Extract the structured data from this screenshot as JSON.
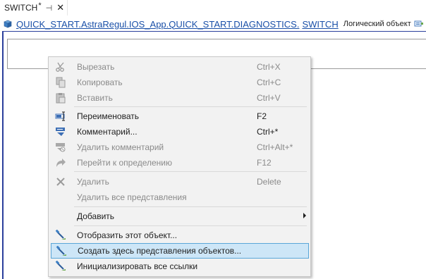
{
  "tab": {
    "title": "SWITCH",
    "modified_mark": "*",
    "pin_glyph": "⊣",
    "close_glyph": "✕"
  },
  "breadcrumb": {
    "path": "QUICK_START.AstraRegul.IOS_App.QUICK_START.DIAGNOSTICS.",
    "current": "SWITCH",
    "type_label": "Логический объект",
    "leading_icon": "cube-icon",
    "trailing_icon": "logical-object-icon"
  },
  "colors": {
    "link": "#1a50a8",
    "highlight_bg": "#cde6f7",
    "highlight_border": "#5aa6d8",
    "canvas_border": "#2b3f9c"
  },
  "menu": {
    "items": [
      {
        "label": "Вырезать",
        "shortcut": "Ctrl+X",
        "icon": "scissors-icon",
        "enabled": false
      },
      {
        "label": "Копировать",
        "shortcut": "Ctrl+C",
        "icon": "copy-icon",
        "enabled": false
      },
      {
        "label": "Вставить",
        "shortcut": "Ctrl+V",
        "icon": "paste-icon",
        "enabled": false
      },
      {
        "label": "Переименовать",
        "shortcut": "F2",
        "icon": "rename-icon",
        "enabled": true
      },
      {
        "label": "Комментарий...",
        "shortcut": "Ctrl+*",
        "icon": "comment-icon",
        "enabled": true
      },
      {
        "label": "Удалить комментарий",
        "shortcut": "Ctrl+Alt+*",
        "icon": "remove-comment-icon",
        "enabled": false
      },
      {
        "label": "Перейти к определению",
        "shortcut": "F12",
        "icon": "goto-definition-icon",
        "enabled": false
      },
      {
        "label": "Удалить",
        "shortcut": "Delete",
        "icon": "delete-icon",
        "enabled": false
      },
      {
        "label": "Удалить все представления",
        "shortcut": "",
        "icon": "",
        "enabled": false
      },
      {
        "label": "Добавить",
        "shortcut": "",
        "icon": "",
        "enabled": true,
        "submenu": true
      },
      {
        "label": "Отобразить этот объект...",
        "shortcut": "",
        "icon": "show-object-icon",
        "enabled": true
      },
      {
        "label": "Создать здесь представления объектов...",
        "shortcut": "",
        "icon": "create-views-icon",
        "enabled": true,
        "highlighted": true
      },
      {
        "label": "Инициализировать все ссылки",
        "shortcut": "",
        "icon": "init-links-icon",
        "enabled": true
      }
    ]
  }
}
